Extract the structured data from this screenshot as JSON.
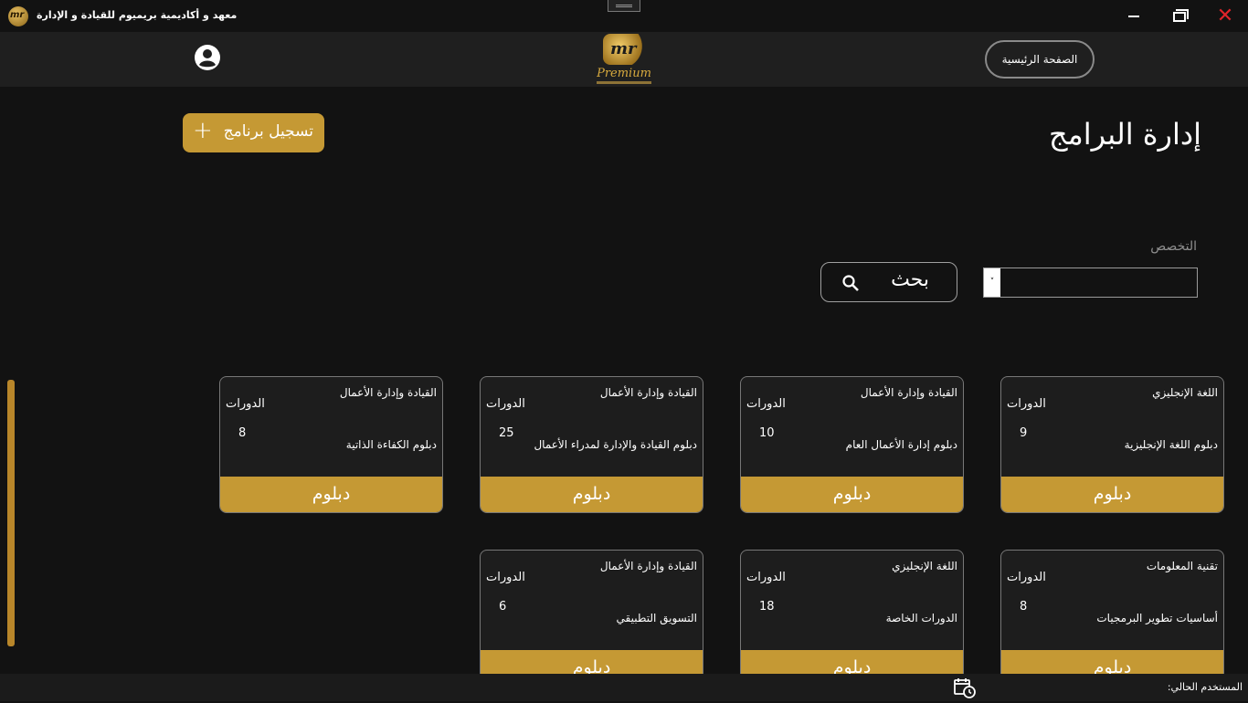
{
  "window": {
    "title": "معهد و أكاديمية بريميوم للقيادة و الإدارة",
    "logo_text": "mr",
    "close_glyph": "✕"
  },
  "navbar": {
    "home_label": "الصفحة الرئيسية",
    "brand_mark": "mr",
    "brand_word": "Premium",
    "account_icon": "account-circle-icon"
  },
  "page": {
    "title": "إدارة البرامج",
    "register_label": "تسجيل برنامج",
    "register_plus": "+"
  },
  "filter": {
    "label": "التخصص",
    "selected": "",
    "caret": "˅",
    "search_label": "بحث"
  },
  "colors": {
    "accent": "#c59934",
    "background": "#121212",
    "navbar": "#1f1f1f",
    "close": "#e0242a"
  },
  "cards": [
    {
      "specialty": "اللغة الإنجليزي",
      "courses_label": "الدورات",
      "count": "9",
      "name": "دبلوم اللغة الإنجليزية",
      "type": "دبلوم"
    },
    {
      "specialty": "القيادة وإدارة الأعمال",
      "courses_label": "الدورات",
      "count": "10",
      "name": "دبلوم إدارة الأعمال العام",
      "type": "دبلوم"
    },
    {
      "specialty": "القيادة وإدارة الأعمال",
      "courses_label": "الدورات",
      "count": "25",
      "name": "دبلوم القيادة والإدارة لمدراء الأعمال",
      "type": "دبلوم"
    },
    {
      "specialty": "القيادة وإدارة الأعمال",
      "courses_label": "الدورات",
      "count": "8",
      "name": "دبلوم الكفاءة الذاتية",
      "type": "دبلوم"
    },
    {
      "specialty": "تقنية المعلومات",
      "courses_label": "الدورات",
      "count": "8",
      "name": "أساسيات تطوير البرمجيات",
      "type": "دبلوم"
    },
    {
      "specialty": "اللغة الإنجليزي",
      "courses_label": "الدورات",
      "count": "18",
      "name": "الدورات الخاصة",
      "type": "دبلوم"
    },
    {
      "specialty": "القيادة وإدارة الأعمال",
      "courses_label": "الدورات",
      "count": "6",
      "name": "التسويق التطبيقي",
      "type": "دبلوم"
    }
  ],
  "status": {
    "current_user_label": "المستخدم الحالي:",
    "icon": "calendar-clock-icon"
  }
}
